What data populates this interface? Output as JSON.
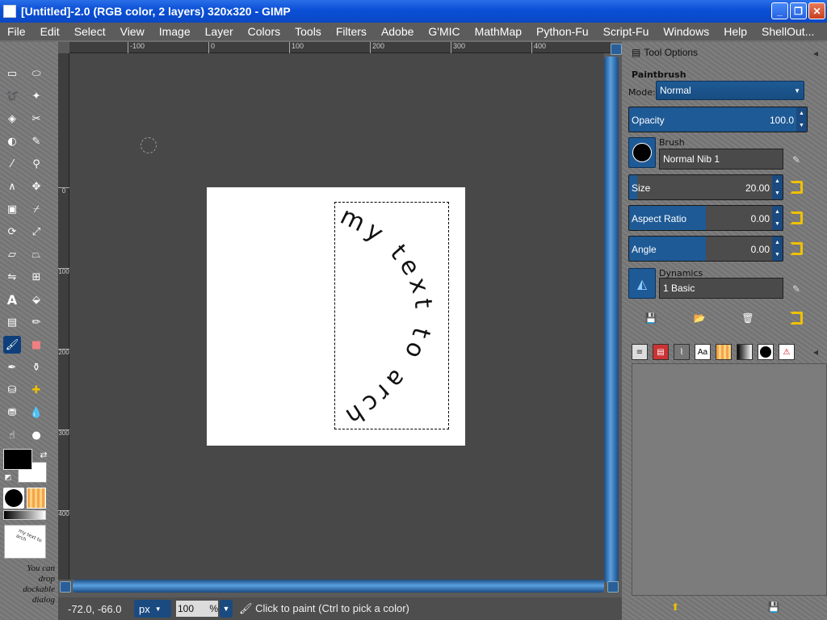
{
  "window": {
    "title": "[Untitled]-2.0 (RGB color, 2 layers) 320x320 - GIMP",
    "minimize_label": "_",
    "maximize_label": "❐",
    "close_label": "✕"
  },
  "menu": [
    "File",
    "Edit",
    "Select",
    "View",
    "Image",
    "Layer",
    "Colors",
    "Tools",
    "Filters",
    "Adobe",
    "G'MIC",
    "MathMap",
    "Python-Fu",
    "Script-Fu",
    "Windows",
    "Help",
    "ShellOut..."
  ],
  "ruler": {
    "top_labels": [
      "-100",
      "0",
      "100",
      "200",
      "300",
      "400"
    ],
    "left_labels": [
      "0",
      "100",
      "200",
      "300",
      "400"
    ]
  },
  "canvas": {
    "text_path_string": "my text to arch",
    "thumbnail_text": "my text to arch"
  },
  "toolbox": {
    "drop_hint": "You can drop dockable dialog"
  },
  "status": {
    "coords": "-72.0, -66.0",
    "unit": "px",
    "zoom": "100",
    "zoom_suffix": "%",
    "message": "Click to paint (Ctrl to pick a color)"
  },
  "tool_options": {
    "header": "Tool Options",
    "tool_name": "Paintbrush",
    "mode_label": "Mode:",
    "mode_value": "Normal",
    "opacity_label": "Opacity",
    "opacity_value": "100.0",
    "opacity": 1.0,
    "brush_label": "Brush",
    "brush_value": "Normal Nib 1",
    "size_label": "Size",
    "size_value": "20.00",
    "size_fill": 0.05,
    "aspect_label": "Aspect Ratio",
    "aspect_value": "0.00",
    "aspect_fill": 0.5,
    "angle_label": "Angle",
    "angle_value": "0.00",
    "angle_fill": 0.5,
    "dynamics_label": "Dynamics",
    "dynamics_value": "1 Basic"
  },
  "colors": {
    "accent": "#1e5a96",
    "titlebar": "#0a4fd6",
    "foreground": "#000000",
    "background": "#ffffff"
  }
}
